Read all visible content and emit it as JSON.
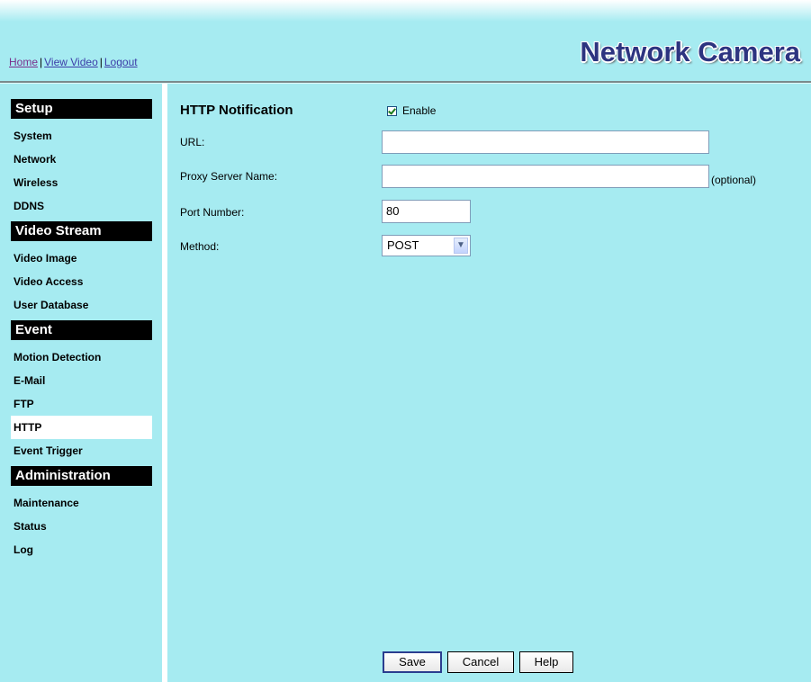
{
  "header": {
    "links": {
      "home": "Home",
      "view_video": "View Video",
      "logout": "Logout",
      "separator": "|"
    },
    "brand": "Network Camera"
  },
  "sidebar": {
    "sections": [
      {
        "title": "Setup",
        "items": [
          "System",
          "Network",
          "Wireless",
          "DDNS"
        ]
      },
      {
        "title": "Video Stream",
        "items": [
          "Video Image",
          "Video Access",
          "User Database"
        ]
      },
      {
        "title": "Event",
        "items": [
          "Motion Detection",
          "E-Mail",
          "FTP",
          "HTTP",
          "Event Trigger"
        ]
      },
      {
        "title": "Administration",
        "items": [
          "Maintenance",
          "Status",
          "Log"
        ]
      }
    ],
    "active_item": "HTTP"
  },
  "form": {
    "title": "HTTP Notification",
    "enable_label": "Enable",
    "enable_checked": true,
    "url_label": "URL:",
    "url_value": "",
    "proxy_label": "Proxy Server Name:",
    "proxy_value": "",
    "proxy_note": "(optional)",
    "port_label": "Port Number:",
    "port_value": "80",
    "method_label": "Method:",
    "method_value": "POST"
  },
  "buttons": {
    "save": "Save",
    "cancel": "Cancel",
    "help": "Help"
  },
  "colors": {
    "background": "#a6ebf1",
    "section_header": "#000000",
    "brand_text": "#2d3480"
  }
}
